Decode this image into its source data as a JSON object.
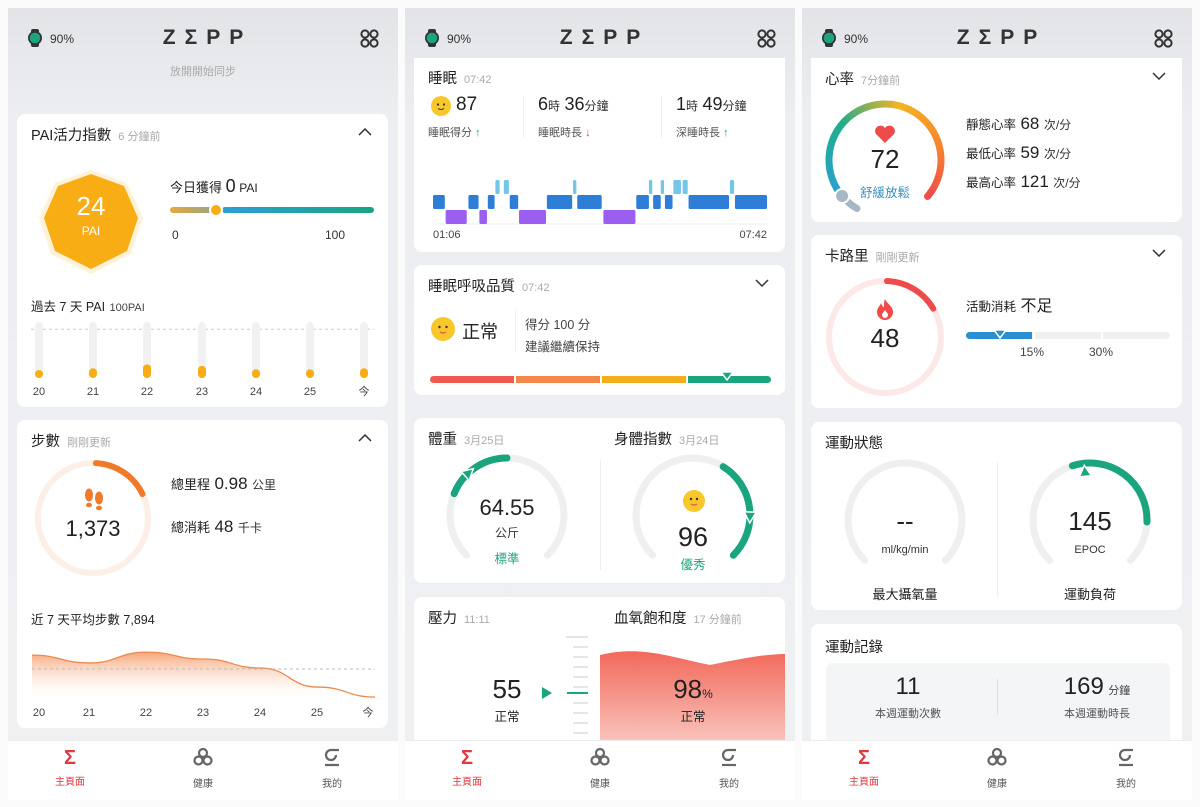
{
  "status": {
    "battery": "90%",
    "brand": "ZΣPP",
    "sync_hint": "放開開始同步"
  },
  "nav": [
    {
      "label": "主頁面",
      "icon": "sigma-home-icon",
      "active": true
    },
    {
      "label": "健康",
      "icon": "health-icon",
      "active": false
    },
    {
      "label": "我的",
      "icon": "profile-icon",
      "active": false
    }
  ],
  "colors": {
    "accent": "#e0393e",
    "green": "#1aa57f",
    "pai": "#f9ad14",
    "steps": "#f07a2a",
    "calorie": "#ef4b4b"
  },
  "pai": {
    "title": "PAI活力指數",
    "updated": "6 分鐘前",
    "value": "24",
    "unit": "PAI",
    "today_label": "今日獲得",
    "today_value": "0",
    "today_unit": "PAI",
    "scale_min": "0",
    "scale_max": "100",
    "week_label": "過去 7 天 PAI",
    "week_target": "100PAI",
    "chart_data": {
      "type": "bar",
      "categories": [
        "20",
        "21",
        "22",
        "23",
        "24",
        "25",
        "今"
      ],
      "values": [
        15,
        20,
        28,
        25,
        18,
        18,
        20
      ],
      "target": 100
    }
  },
  "steps": {
    "title": "步數",
    "updated": "剛剛更新",
    "value": "1,373",
    "progress": 0.17,
    "distance_label": "總里程",
    "distance": "0.98",
    "distance_unit": "公里",
    "burn_label": "總消耗",
    "burn": "48",
    "burn_unit": "千卡",
    "avg_label": "近 7 天平均步數",
    "avg": "7,894",
    "chart_data": {
      "type": "area",
      "categories": [
        "20",
        "21",
        "22",
        "23",
        "24",
        "25",
        "今"
      ],
      "values": [
        11100,
        9300,
        11800,
        10200,
        8100,
        3700,
        1373
      ],
      "average": 7894
    }
  },
  "sleep": {
    "title": "睡眠",
    "time": "07:42",
    "score": "87",
    "score_label": "睡眠得分",
    "score_trend": "up",
    "duration_h": "6",
    "duration_m": "36",
    "h_unit": "時",
    "m_unit": "分鐘",
    "duration_label": "睡眠時長",
    "duration_trend": "down",
    "deep_h": "1",
    "deep_m": "49",
    "deep_label": "深睡時長",
    "deep_trend": "up",
    "start": "01:06",
    "end": "07:42",
    "chart_data": {
      "type": "timeline",
      "start": "01:06",
      "end": "07:42",
      "segments": [
        [
          "01:06",
          "01:20",
          "light"
        ],
        [
          "01:21",
          "01:46",
          "deep"
        ],
        [
          "01:48",
          "02:00",
          "light"
        ],
        [
          "02:01",
          "02:10",
          "deep"
        ],
        [
          "02:11",
          "02:19",
          "light"
        ],
        [
          "02:20",
          "02:25",
          "rem"
        ],
        [
          "02:30",
          "02:36",
          "rem"
        ],
        [
          "02:37",
          "02:47",
          "light"
        ],
        [
          "02:48",
          "03:20",
          "deep"
        ],
        [
          "03:21",
          "03:51",
          "light"
        ],
        [
          "03:52",
          "03:56",
          "rem"
        ],
        [
          "03:57",
          "04:26",
          "light"
        ],
        [
          "04:28",
          "05:06",
          "deep"
        ],
        [
          "05:07",
          "05:22",
          "light"
        ],
        [
          "05:22",
          "05:26",
          "rem"
        ],
        [
          "05:27",
          "05:36",
          "light"
        ],
        [
          "05:36",
          "05:40",
          "rem"
        ],
        [
          "05:41",
          "05:50",
          "light"
        ],
        [
          "05:51",
          "06:00",
          "rem"
        ],
        [
          "06:02",
          "06:08",
          "rem"
        ],
        [
          "06:09",
          "06:57",
          "light"
        ],
        [
          "06:58",
          "07:03",
          "rem"
        ],
        [
          "07:04",
          "07:42",
          "light"
        ]
      ]
    }
  },
  "breathing": {
    "title": "睡眠呼吸品質",
    "time": "07:42",
    "status": "正常",
    "score_text": "得分 100 分",
    "advice": "建議繼續保持",
    "level": 0.87
  },
  "weight": {
    "title": "體重",
    "date": "3月25日",
    "value": "64.55",
    "unit": "公斤",
    "status": "標準"
  },
  "bmi": {
    "title": "身體指數",
    "date": "3月24日",
    "value": "96",
    "status": "優秀"
  },
  "stress": {
    "title": "壓力",
    "time": "11:11",
    "value": "55",
    "status": "正常"
  },
  "spo2": {
    "title": "血氧飽和度",
    "updated": "17 分鐘前",
    "value": "98",
    "unit": "%",
    "status": "正常"
  },
  "heart": {
    "title": "心率",
    "updated": "7分鐘前",
    "value": "72",
    "status": "舒緩放鬆",
    "rows": [
      {
        "label": "靜態心率",
        "value": "68",
        "unit": "次/分"
      },
      {
        "label": "最低心率",
        "value": "59",
        "unit": "次/分"
      },
      {
        "label": "最高心率",
        "value": "121",
        "unit": "次/分"
      }
    ]
  },
  "calorie": {
    "title": "卡路里",
    "updated": "剛剛更新",
    "value": "48",
    "progress": 0.16,
    "activity_label": "活動消耗",
    "activity_status": "不足",
    "mark1": "15%",
    "mark2": "30%",
    "level_percent": 7.5
  },
  "fitness": {
    "title": "運動狀態",
    "vo2_value": "--",
    "vo2_unit": "ml/kg/min",
    "vo2_label": "最大攝氧量",
    "load_value": "145",
    "load_unit": "EPOC",
    "load_label": "運動負荷"
  },
  "workouts": {
    "title": "運動記錄",
    "count": "11",
    "count_label": "本週運動次數",
    "minutes": "169",
    "minutes_unit": "分鐘",
    "minutes_label": "本週運動時長"
  }
}
